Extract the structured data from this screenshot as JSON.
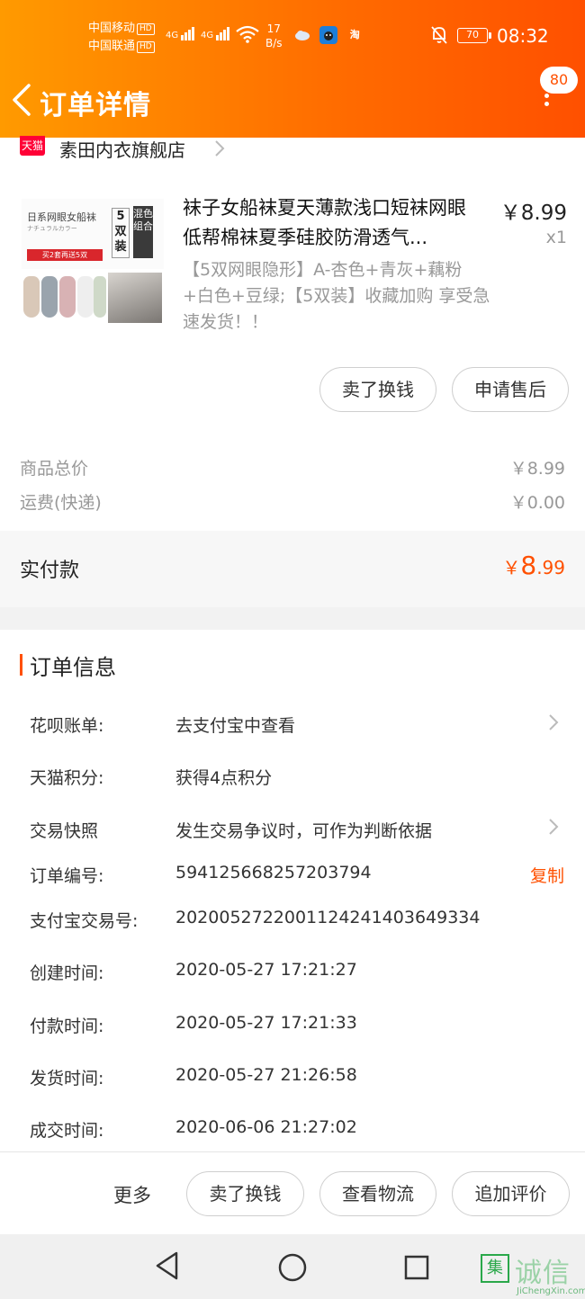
{
  "status_bar": {
    "carrier1": "中国移动",
    "carrier2": "中国联通",
    "hd": "HD",
    "net1": "4G",
    "net2": "4G",
    "speed_value": "17",
    "speed_unit": "B/s",
    "app_icon_tb": "淘",
    "battery": "70",
    "time": "08:32"
  },
  "header": {
    "title": "订单详情",
    "message_count": "80",
    "back_icon": "chevron-left-icon",
    "more_icon": "more-vertical-icon"
  },
  "shop": {
    "badge": "天猫",
    "name": "素田内衣旗舰店"
  },
  "product": {
    "title": "袜子女船袜夏天薄款浅口短袜网眼低帮棉袜夏季硅胶防滑透气...",
    "price": "￥8.99",
    "quantity": "x1",
    "spec": "【5双网眼隐形】A-杏色+青灰+藕粉+白色+豆绿;【5双装】收藏加购 享受急速发货！！",
    "thumb": {
      "title": "日系网眼女船袜",
      "subtitle": "ナチュラルカラー",
      "promo": "买2套再送5双",
      "pack": "5双装",
      "mix": "混色组合"
    },
    "actions": [
      "卖了换钱",
      "申请售后"
    ]
  },
  "totals": {
    "goods_label": "商品总价",
    "goods_value": "￥8.99",
    "shipping_label": "运费(快递)",
    "shipping_value": "￥0.00",
    "paid_label": "实付款",
    "paid_currency": "￥",
    "paid_int": "8",
    "paid_dec": ".99"
  },
  "order_info": {
    "title": "订单信息",
    "rows": [
      {
        "label": "花呗账单:",
        "value": "去支付宝中查看"
      },
      {
        "label": "天猫积分:",
        "value": "获得4点积分"
      },
      {
        "label": "交易快照",
        "value": "发生交易争议时，可作为判断依据"
      },
      {
        "label": "订单编号:",
        "value": "594125668257203794"
      },
      {
        "label": "支付宝交易号:",
        "value": "2020052722001124241403649334"
      },
      {
        "label": "创建时间:",
        "value": "2020-05-27 17:21:27"
      },
      {
        "label": "付款时间:",
        "value": "2020-05-27 17:21:33"
      },
      {
        "label": "发货时间:",
        "value": "2020-05-27 21:26:58"
      },
      {
        "label": "成交时间:",
        "value": "2020-06-06 21:27:02"
      }
    ],
    "copy_label": "复制"
  },
  "bottom_bar": {
    "more": "更多",
    "buttons": [
      "卖了换钱",
      "查看物流",
      "追加评价"
    ]
  },
  "watermark": {
    "mark": "集",
    "text": "诚信",
    "url": "JiChengXin.com"
  },
  "colors": {
    "accent": "#ff5000",
    "header_start": "#ff9a00",
    "tmall_red": "#ff0036"
  }
}
